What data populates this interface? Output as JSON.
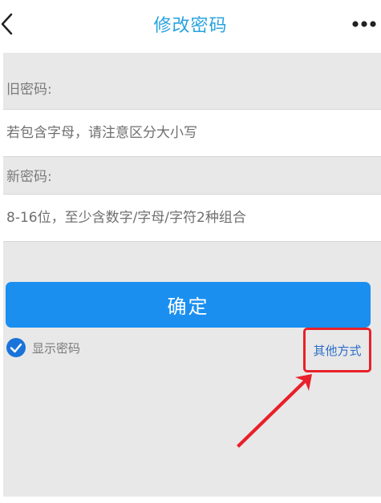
{
  "header": {
    "title": "修改密码",
    "back_icon": "chevron-left-icon",
    "more_icon": "more-dots-icon"
  },
  "form": {
    "old_password": {
      "label": "旧密码:",
      "placeholder": "若包含字母，请注意区分大小写"
    },
    "new_password": {
      "label": "新密码:",
      "placeholder": "8-16位，至少含数字/字母/字符2种组合"
    },
    "confirm_label": "确定",
    "show_password": {
      "label": "显示密码",
      "checked": true
    },
    "other_method_label": "其他方式"
  },
  "colors": {
    "title": "#29a3dd",
    "primary_button": "#1a8ff0",
    "link": "#2c6ec9",
    "annotation": "#e8202a",
    "background": "#e8e8e8"
  }
}
